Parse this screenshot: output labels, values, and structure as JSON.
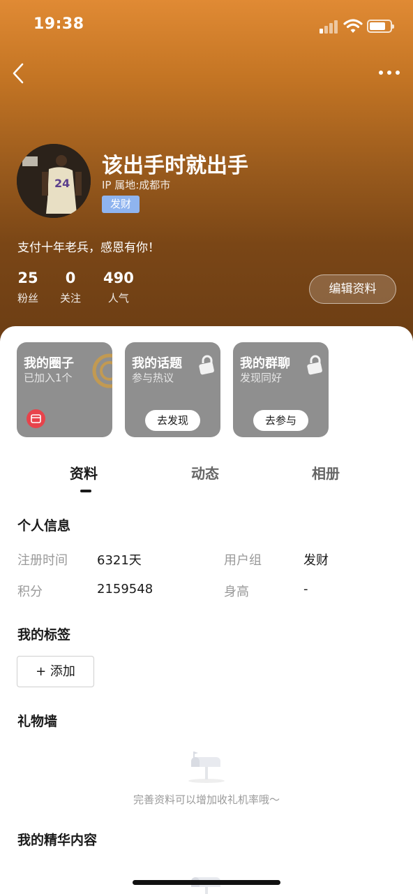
{
  "status_bar": {
    "time": "19:38"
  },
  "profile": {
    "nickname": "该出手时就出手",
    "ip_location": "IP 属地:成都市",
    "group_badge": "发财",
    "bio": "支付十年老兵，感恩有你！",
    "stats": [
      {
        "value": "25",
        "label": "粉丝"
      },
      {
        "value": "0",
        "label": "关注"
      },
      {
        "value": "490",
        "label": "人气"
      }
    ],
    "edit_label": "编辑资料"
  },
  "cards": [
    {
      "title": "我的圈子",
      "subtitle": "已加入1个"
    },
    {
      "title": "我的话题",
      "subtitle": "参与热议",
      "button": "去发现"
    },
    {
      "title": "我的群聊",
      "subtitle": "发现同好",
      "button": "去参与"
    }
  ],
  "tabs": [
    {
      "label": "资料",
      "active": true
    },
    {
      "label": "动态",
      "active": false
    },
    {
      "label": "相册",
      "active": false
    }
  ],
  "personal_info": {
    "title": "个人信息",
    "fields": [
      {
        "label": "注册时间",
        "value": "6321天"
      },
      {
        "label": "用户组",
        "value": "发财"
      },
      {
        "label": "积分",
        "value": "2159548"
      },
      {
        "label": "身高",
        "value": "-"
      }
    ]
  },
  "tags": {
    "title": "我的标签",
    "add_label": "+ 添加"
  },
  "gift_wall": {
    "title": "礼物墙",
    "empty_hint": "完善资料可以增加收礼机率哦～"
  },
  "featured": {
    "title": "我的精华内容"
  },
  "colors": {
    "header_top": "#e08a34",
    "header_bottom": "#6b3d14",
    "badge": "#8fb4ef",
    "card_bg": "#8f8f8f",
    "shop_icon": "#e8434b"
  },
  "icons": [
    "back-icon",
    "more-icon",
    "signal-icon",
    "wifi-icon",
    "battery-icon",
    "lock-icon",
    "shop-icon",
    "mailbox-icon"
  ]
}
